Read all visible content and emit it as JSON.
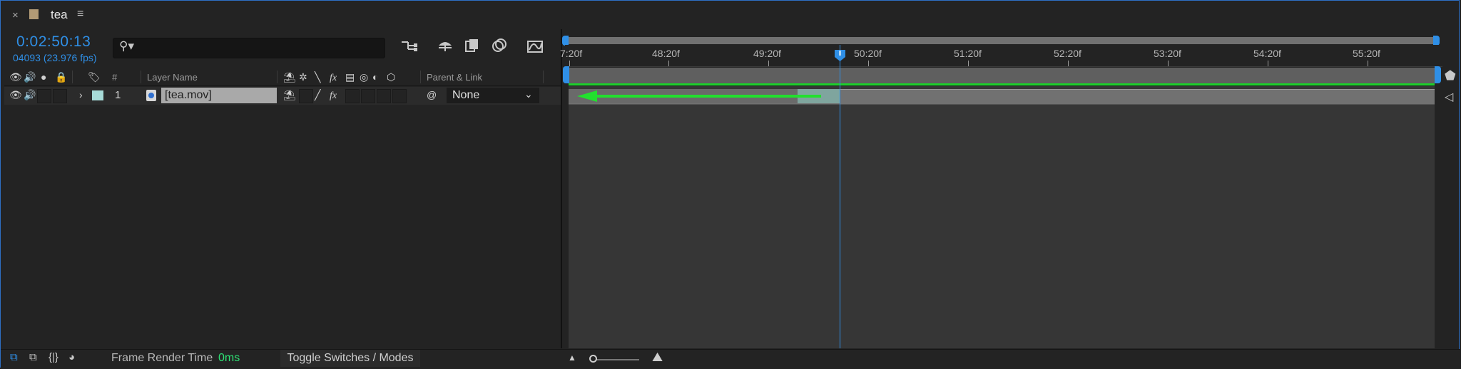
{
  "tab": {
    "close": "×",
    "title": "tea",
    "menu": "≡"
  },
  "time": {
    "timecode": "0:02:50:13",
    "frames": "04093 (23.976 fps)"
  },
  "search": {
    "placeholder": ""
  },
  "columns": {
    "number": "#",
    "layer_name": "Layer Name",
    "parent_link": "Parent & Link"
  },
  "layer": {
    "number": "1",
    "name": "[tea.mov]",
    "parent": "None",
    "label_color": "#a7dbd8"
  },
  "ruler": {
    "labels": [
      "7:20f",
      "48:20f",
      "49:20f",
      "50:20f",
      "51:20f",
      "52:20f",
      "53:20f",
      "54:20f",
      "55:20f"
    ]
  },
  "bottom": {
    "frame_render_label": "Frame Render Time",
    "frame_render_value": "0ms",
    "toggle_label": "Toggle Switches / Modes"
  },
  "colors": {
    "accent": "#2f8fe6",
    "work_area_line": "#1ccf2b",
    "render_value": "#2ee074"
  }
}
